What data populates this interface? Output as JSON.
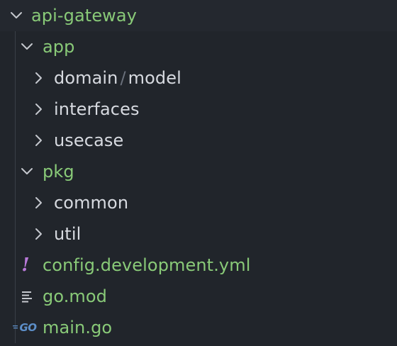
{
  "tree": {
    "root": {
      "label": "api-gateway",
      "icon": "chevron-down-icon"
    },
    "app": {
      "label": "app",
      "icon": "chevron-down-icon"
    },
    "app_children": {
      "domain_part1": "domain",
      "domain_separator": "/",
      "domain_part2": "model",
      "interfaces": "interfaces",
      "usecase": "usecase"
    },
    "pkg": {
      "label": "pkg",
      "icon": "chevron-down-icon"
    },
    "pkg_children": {
      "common": "common",
      "util": "util"
    },
    "files": {
      "config": {
        "label": "config.development.yml",
        "icon": "yaml-icon",
        "icon_glyph": "!"
      },
      "gomod": {
        "label": "go.mod",
        "icon": "lines-icon"
      },
      "maingo": {
        "label": "main.go",
        "icon": "go-icon",
        "icon_glyph": "GO"
      }
    }
  },
  "colors": {
    "background": "#21252b",
    "folder_open_text": "#89ca78",
    "folder_closed_text": "#d7dae0",
    "chevron": "#c5c8ce",
    "yaml_icon": "#b879d8",
    "go_icon": "#5d8fc9"
  }
}
